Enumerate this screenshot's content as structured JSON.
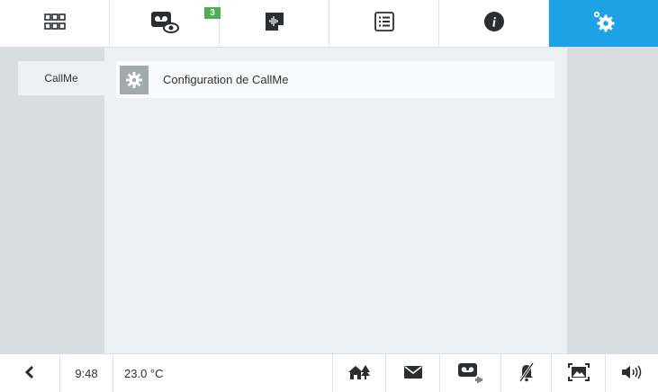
{
  "topbar": {
    "tabs": [
      {
        "icon": "grid-icon"
      },
      {
        "icon": "voicemail-view-icon",
        "badge": "3"
      },
      {
        "icon": "audio-message-icon"
      },
      {
        "icon": "list-icon"
      },
      {
        "icon": "info-icon"
      },
      {
        "icon": "settings-gear-icon",
        "active": true
      }
    ],
    "accent_color": "#1ea2e6",
    "badge_color": "#4caf50"
  },
  "sidebar": {
    "items": [
      {
        "label": "CallMe"
      }
    ]
  },
  "main": {
    "items": [
      {
        "icon": "gear-icon",
        "label": "Configuration de CallMe"
      }
    ]
  },
  "statusbar": {
    "time": "9:48",
    "temperature": "23.0 °C",
    "icons": [
      "back-arrow-icon",
      "home-scene-icon",
      "mail-icon",
      "voicemail-audio-icon",
      "mute-icon",
      "picture-frame-icon",
      "speaker-icon"
    ]
  }
}
